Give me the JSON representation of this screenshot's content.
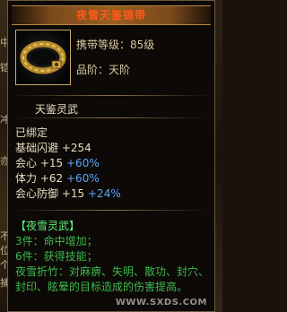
{
  "item": {
    "name": "夜雪天鉴锦带",
    "carry_level_label": "携带等级：85级",
    "grade_label": "品阶：天阶",
    "appraisal": "天鉴灵武",
    "bound": "已绑定"
  },
  "stats": [
    {
      "label": "基础闪避",
      "value": "+254",
      "pct": ""
    },
    {
      "label": "会心",
      "value": "+15",
      "pct": "+60%"
    },
    {
      "label": "体力",
      "value": "+62",
      "pct": "+60%"
    },
    {
      "label": "会心防御",
      "value": "+15",
      "pct": "+24%"
    }
  ],
  "set": {
    "title": "【夜雪灵武】",
    "lines": [
      "3件：命中增加；",
      "6件：获得技能；",
      "夜雪折竹：对麻痹、失明、散功、封穴、",
      "封印、眩晕的目标造成的伤害提高。"
    ]
  },
  "side_glyphs": [
    "中",
    "铠",
    "冲",
    "亦",
    "不",
    "位",
    "个",
    "捕"
  ],
  "watermark": "WWW.SXDS.COM",
  "colors": {
    "title": "#ff5a1a",
    "set_title": "#5ef07a",
    "set_line": "#3fb84f",
    "percent": "#5aa6ff"
  }
}
